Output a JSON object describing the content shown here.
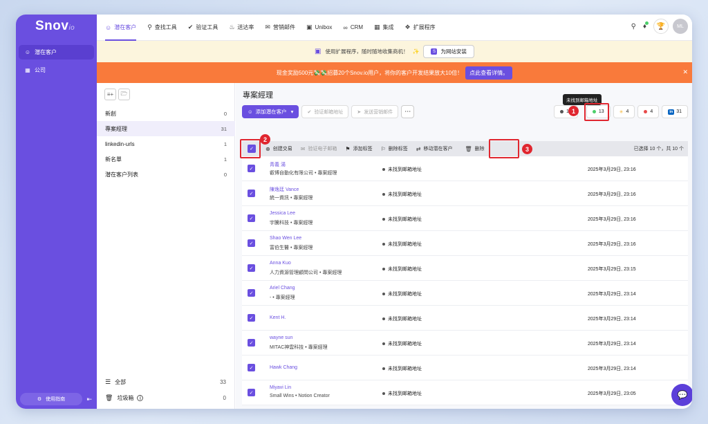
{
  "app": {
    "logo_main": "Snov",
    "logo_sub": "io"
  },
  "sidebar": {
    "items": [
      {
        "label": "潜在客户",
        "icon": "users-icon"
      },
      {
        "label": "公司",
        "icon": "building-icon"
      }
    ],
    "guide": "使用指南"
  },
  "topnav": {
    "items": [
      {
        "label": "潜在客户",
        "icon": "users-icon"
      },
      {
        "label": "查找工具",
        "icon": "search-icon"
      },
      {
        "label": "验证工具",
        "icon": "check-circle-icon"
      },
      {
        "label": "送达率",
        "icon": "flame-icon"
      },
      {
        "label": "营销邮件",
        "icon": "mail-icon"
      },
      {
        "label": "Unibox",
        "icon": "inbox-icon"
      },
      {
        "label": "CRM",
        "icon": "link-icon"
      },
      {
        "label": "集成",
        "icon": "grid-icon"
      },
      {
        "label": "扩展程序",
        "icon": "puzzle-icon"
      }
    ],
    "avatar": "ML"
  },
  "promo": {
    "text": "使用扩展程序，随时随地收集商机！",
    "install": "为网站安装"
  },
  "banner": {
    "text": "现金奖励500元💸💸招募20个Snov.io用户，将你的客户开发结果放大10倍！",
    "cta": "点此查看详情。"
  },
  "lists": {
    "items": [
      {
        "name": "新創",
        "count": "0"
      },
      {
        "name": "專案經理",
        "count": "31"
      },
      {
        "name": "linkedin-urls",
        "count": "1"
      },
      {
        "name": "新名單",
        "count": "1"
      },
      {
        "name": "潜在客户列表",
        "count": "0"
      }
    ],
    "all": {
      "label": "全部",
      "count": "33"
    },
    "trash": {
      "label": "垃圾箱",
      "count": "0"
    }
  },
  "main": {
    "title": "專案經理",
    "tooltip": "未找到邮箱地址",
    "add_btn": "添加潜在客户",
    "verify_btn": "验证邮箱地址",
    "send_btn": "发送营销邮件",
    "stats": [
      {
        "value": "10",
        "color": "#555555"
      },
      {
        "value": "13",
        "color": "#4ccf6a"
      },
      {
        "value": "4",
        "color": "#f5b83d"
      },
      {
        "value": "4",
        "color": "#e84a4a"
      },
      {
        "value": "31",
        "color": "#0a66c2"
      }
    ],
    "stats_linkedin": "in",
    "toolbar": {
      "create": "创建交易",
      "verify": "验证电子邮箱",
      "add_tag": "添加标签",
      "del_tag": "删除标签",
      "move": "移动潜在客户",
      "delete": "删除",
      "summary": "已选择 10 个，共 10 个"
    },
    "annotations": [
      "1",
      "2",
      "3"
    ]
  },
  "rows": [
    {
      "name": "青義 湯",
      "sub": "叡博自動化有限公司 • 專案經理",
      "status": "未找到邮箱地址",
      "date": "2025年3月29日, 23:16"
    },
    {
      "name": "陳逸廷 Vance",
      "sub": "統一資訊 • 專案經理",
      "status": "未找到邮箱地址",
      "date": "2025年3月29日, 23:16"
    },
    {
      "name": "Jessica Lee",
      "sub": "宇騰科技 • 專案經理",
      "status": "未找到邮箱地址",
      "date": "2025年3月29日, 23:16"
    },
    {
      "name": "Shao Wen Lee",
      "sub": "富伯生醫 • 專案經理",
      "status": "未找到邮箱地址",
      "date": "2025年3月29日, 23:16"
    },
    {
      "name": "Anna Kuo",
      "sub": "人力資源管理顧問公司 • 專案經理",
      "status": "未找到邮箱地址",
      "date": "2025年3月29日, 23:15"
    },
    {
      "name": "Ariel Chang",
      "sub": "- • 專案經理",
      "status": "未找到邮箱地址",
      "date": "2025年3月29日, 23:14"
    },
    {
      "name": "Kent H.",
      "sub": "",
      "status": "未找到邮箱地址",
      "date": "2025年3月29日, 23:14"
    },
    {
      "name": "wayne sun",
      "sub": "MITAC神雲科技 • 專案經理",
      "status": "未找到邮箱地址",
      "date": "2025年3月29日, 23:14"
    },
    {
      "name": "Hawk Chang",
      "sub": "",
      "status": "未找到邮箱地址",
      "date": "2025年3月29日, 23:14"
    },
    {
      "name": "Miyavi Lin",
      "sub": "Small Wins • Notion Creator",
      "status": "未找到邮箱地址",
      "date": "2025年3月29日, 23:05"
    }
  ]
}
